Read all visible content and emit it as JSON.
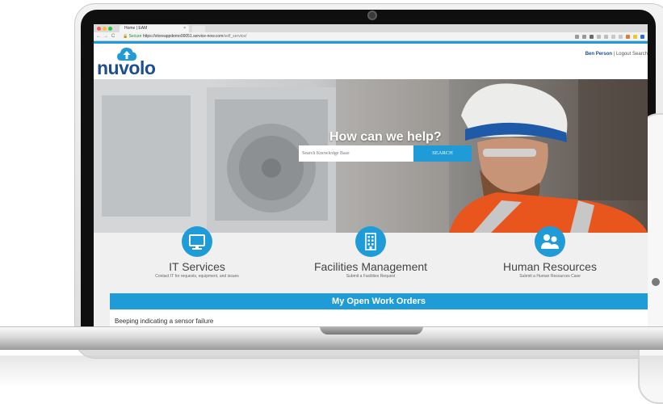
{
  "browser": {
    "tab_title": "Home | EAM",
    "tab_close": "×",
    "nav": {
      "back": "←",
      "forward": "→",
      "reload": "C"
    },
    "url_secure": "Secure",
    "url_host": "https://storeappdemo00051.service-now.com",
    "url_path": "/self_service/",
    "traffic_colors": [
      "#ff5f57",
      "#febc2e",
      "#28c840"
    ]
  },
  "header": {
    "logo": "nuvolo",
    "user_name": "Ben Person",
    "separator": "|",
    "logout": "Logout",
    "search": "Search"
  },
  "hero": {
    "title": "How can we help?",
    "search_placeholder": "Search Knowledge Base",
    "search_button": "SEARCH"
  },
  "services": [
    {
      "title": "IT Services",
      "subtitle": "Contact IT for requests, equipment, and issues",
      "icon": "monitor-icon"
    },
    {
      "title": "Facilities Management",
      "subtitle": "Submit a Facilities Request",
      "icon": "building-icon"
    },
    {
      "title": "Human Resources",
      "subtitle": "Submit a Human Resources Case",
      "icon": "people-icon"
    }
  ],
  "orders": {
    "heading": "My Open Work Orders",
    "items": [
      "Beeping indicating a sensor failure"
    ]
  },
  "colors": {
    "accent": "#1f9bd7",
    "brand": "#1f4e8f"
  }
}
